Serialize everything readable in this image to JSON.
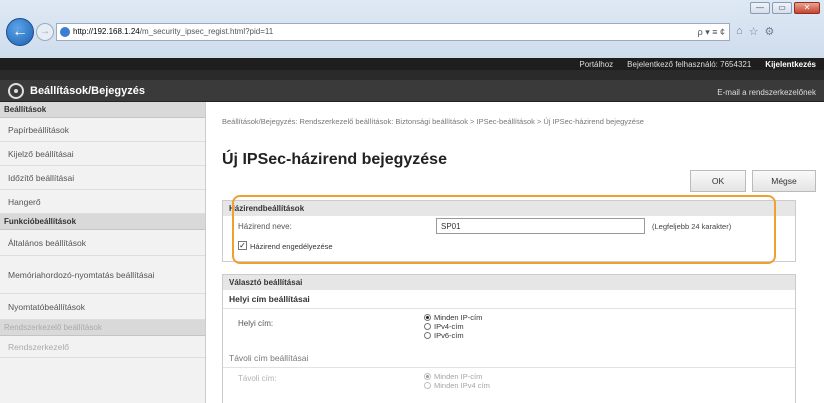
{
  "browser": {
    "url_host": "http://192.168.1.24",
    "url_path": "/m_security_ipsec_regist.html?pid=11",
    "addr_actions": "ρ ▾ ≡ ¢",
    "tab_icons": [
      "⌂",
      "☆",
      "⚙"
    ],
    "window_controls": [
      "—",
      "▭",
      "✕"
    ]
  },
  "header": {
    "portal_label": "Portálhoz",
    "logged_in_label": "Bejelentkező felhasználó:",
    "user_id": "7654321",
    "logout_label": "Kijelentkezés",
    "app_title": "Beállítások/Bejegyzés",
    "email_admin": "E-mail a rendszerkezelőnek"
  },
  "sidebar": {
    "section_settings": "Beállítások",
    "items_settings": [
      "Papírbeállítások",
      "Kijelző beállításai",
      "Időzítő beállításai",
      "Hangerő"
    ],
    "section_function": "Funkcióbeállítások",
    "items_function": [
      "Általános beállítások",
      "Memóriahordozó-nyomtatás beállításai",
      "Nyomtatóbeállítások"
    ],
    "section_admin": "Rendszerkezelő beállítások",
    "items_admin": [
      "Rendszerkezelő"
    ]
  },
  "main": {
    "breadcrumb": "Beállítások/Bejegyzés: Rendszerkezelő beállítások: Biztonsági beállítások > IPSec-beállítások > Új IPSec-házirend bejegyzése",
    "page_title": "Új IPSec-házirend bejegyzése",
    "ok_label": "OK",
    "cancel_label": "Mégse",
    "policy_section": "Házirendbeállítások",
    "policy_name_label": "Házirend neve:",
    "policy_name_value": "SP01",
    "policy_name_hint": "(Legfeljebb 24 karakter)",
    "enable_policy_label": "Házirend engedélyezése",
    "enable_policy_checked": true,
    "selector_section": "Választó beállításai",
    "local_address_head": "Helyi cím beállításai",
    "local_address_label": "Helyi cím:",
    "local_address_options": [
      "Minden IP-cím",
      "IPv4-cím",
      "IPv6-cím"
    ],
    "local_address_selected": 0,
    "remote_address_head": "Távoli cím beállításai",
    "remote_address_label": "Távoli cím:",
    "remote_address_options": [
      "Minden IP-cím",
      "Minden IPv4 cím"
    ],
    "remote_address_selected": 0
  }
}
